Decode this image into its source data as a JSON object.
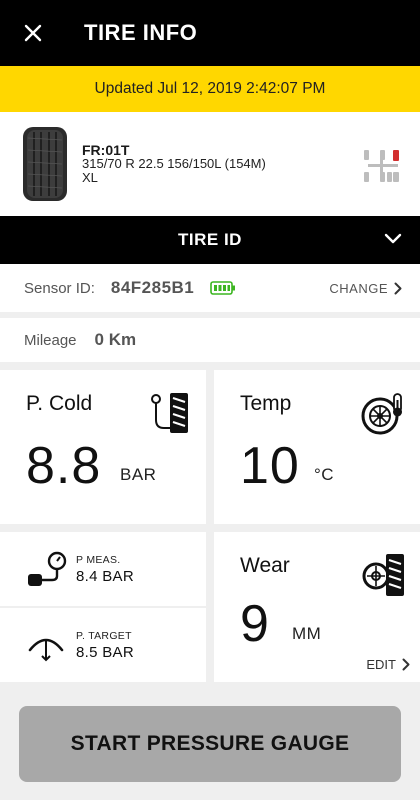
{
  "header": {
    "title": "TIRE INFO",
    "close_icon": "close-icon"
  },
  "updated": {
    "text": "Updated Jul 12, 2019 2:42:07 PM"
  },
  "tire": {
    "name": "FR:01T",
    "size": "315/70 R 22.5 156/150L (154M)",
    "load": "XL"
  },
  "tire_id": {
    "label": "TIRE ID"
  },
  "sensor": {
    "label": "Sensor ID:",
    "value": "84F285B1",
    "change_label": "CHANGE"
  },
  "mileage": {
    "label": "Mileage",
    "value": "0 Km"
  },
  "pressure_cold": {
    "title": "P. Cold",
    "value": "8.8",
    "unit": "BAR"
  },
  "temperature": {
    "title": "Temp",
    "value": "10",
    "unit": "°C"
  },
  "pressure_measured": {
    "label": "P MEAS.",
    "value": "8.4 BAR"
  },
  "pressure_target": {
    "label": "P. TARGET",
    "value": "8.5 BAR"
  },
  "wear": {
    "title": "Wear",
    "value": "9",
    "unit": "MM",
    "edit_label": "EDIT"
  },
  "actions": {
    "start_label": "START PRESSURE GAUGE"
  },
  "colors": {
    "accent": "#ffd700",
    "bar": "#000000",
    "battery": "#3cb521",
    "button": "#a8a8a8",
    "alert": "#d32f2f"
  }
}
